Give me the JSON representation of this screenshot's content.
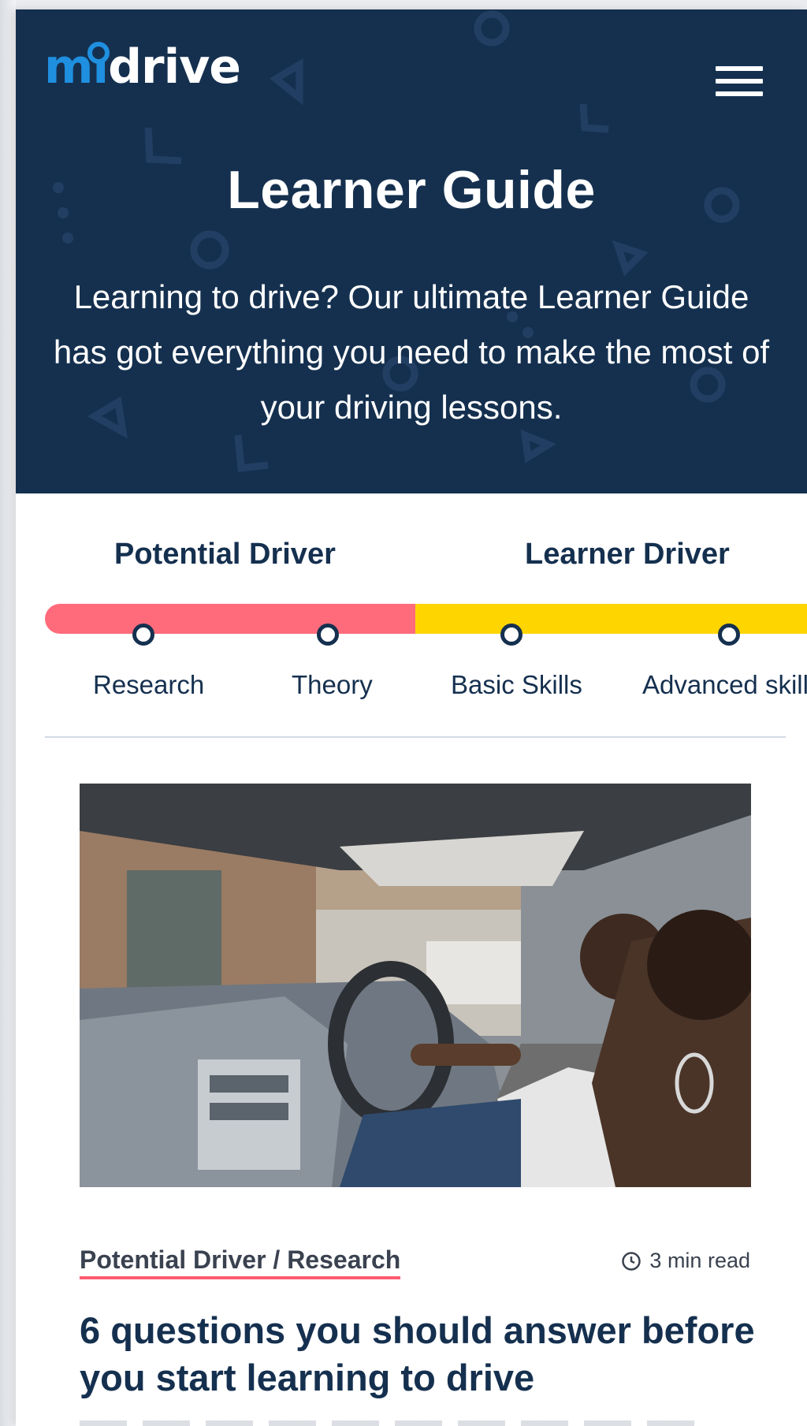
{
  "brand": {
    "logo_text": "midrive",
    "logo_mi": "mi",
    "logo_drive": "drive"
  },
  "hero": {
    "title": "Learner Guide",
    "description": "Learning to drive? Our ultimate Learner Guide has got everything you need to make the most of your driving lessons."
  },
  "progress": {
    "stages": [
      {
        "label": "Potential Driver",
        "color": "#ff6b7b"
      },
      {
        "label": "Learner Driver",
        "color": "#ffd500"
      }
    ],
    "steps": [
      {
        "label": "Research"
      },
      {
        "label": "Theory"
      },
      {
        "label": "Basic Skills"
      },
      {
        "label": "Advanced skill"
      }
    ]
  },
  "article": {
    "image_alt": "Two women in a car, one driving",
    "crumb": "Potential Driver / Research",
    "read_time": "3 min read",
    "title": "6 questions you should answer before you start learning to drive"
  },
  "colors": {
    "navy": "#15304f",
    "brand_blue": "#1f8fe0",
    "pink": "#ff6b7b",
    "yellow": "#ffd500"
  }
}
